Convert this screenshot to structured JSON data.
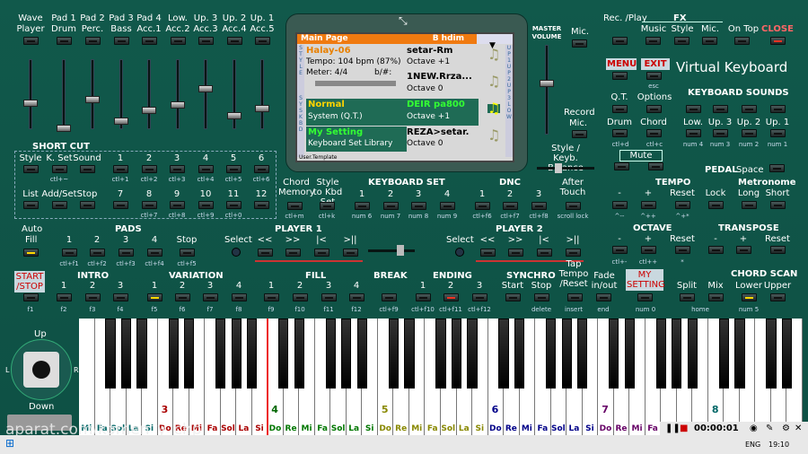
{
  "top_labels": [
    [
      "Wave",
      "Player"
    ],
    [
      "Pad 1",
      "Drum"
    ],
    [
      "Pad 2",
      "Perc."
    ],
    [
      "Pad 3",
      "Bass"
    ],
    [
      "Pad 4",
      "Acc.1"
    ],
    [
      "Low.",
      "Acc.2"
    ],
    [
      "Up. 3",
      "Acc.3"
    ],
    [
      "Up. 2",
      "Acc.4"
    ],
    [
      "Up. 1",
      "Acc.5"
    ]
  ],
  "shortcut": {
    "title": "SHORT CUT",
    "row1": [
      "Style",
      "K. Set",
      "Sound",
      "1",
      "2",
      "3",
      "4",
      "5",
      "6"
    ],
    "row1_keys": [
      "ctl+~",
      "ctl+1",
      "ctl+2",
      "ctl+3",
      "ctl+4",
      "ctl+5",
      "ctl+6"
    ],
    "row2": [
      "List",
      "Add/Set",
      "Stop",
      "7",
      "8",
      "9",
      "10",
      "11",
      "12"
    ],
    "row2_keys": [
      "ctl+7",
      "ctl+8",
      "ctl+9",
      "ctl+0"
    ]
  },
  "screen": {
    "tab": "Main Page",
    "key": "B hdim",
    "style_name": "Halay-06",
    "tempo": "Tempo: 104 bpm (87%)",
    "meter": "Meter: 4/4",
    "bpm": "b/#:",
    "sound1": "setar-Rm",
    "sound1_oct": "Octave +1",
    "sound2": "1NEW.Rrza...",
    "sound2_oct": "Octave 0",
    "sys_name": "Normal",
    "sys_sub": "System (Q.T.)",
    "sound3": "DEIR pa800",
    "sound3_oct": "Octave +1",
    "kbd_name": "My Setting",
    "kbd_sub": "Keyboard Set Library",
    "sound4": "REZA>setar.",
    "sound4_oct": "Octave 0",
    "footer": "User.Template",
    "side_left": "STYLE",
    "side_left2": "SYSKBD",
    "side_right": "UP1UP2UP3LOW"
  },
  "master": {
    "title": "MASTER VOLUME",
    "mic": "Mic.",
    "record": "Record",
    "record_mic": "Mic.",
    "balance": "Style / Keyb. Balance"
  },
  "right": {
    "rec_play": "Rec. /Play",
    "fx": "FX",
    "music": "Music",
    "style": "Style",
    "mic": "Mic.",
    "on_top": "On Top",
    "close": "CLOSE",
    "menu": "MENU",
    "exit": "EXIT",
    "esc": "esc",
    "title": "Virtual Keyboard",
    "qt": "Q.T.",
    "options": "Options",
    "drum": "Drum",
    "chord": "Chord",
    "ctld": "ctl+d",
    "ctlc": "ctl+c",
    "mute": "Mute",
    "kbd_sounds": "KEYBOARD SOUNDS",
    "ks": [
      "Low.",
      "Up. 3",
      "Up. 2",
      "Up. 1"
    ],
    "ks_keys": [
      "num 4",
      "num 3",
      "num 2",
      "num 1"
    ],
    "pedal": "PEDAL",
    "space": "Space",
    "tempo": "TEMPO",
    "metronome": "Metronome",
    "tempo_btns": [
      "-",
      "+",
      "Reset",
      "Lock",
      "Long",
      "Short"
    ],
    "tempo_keys": [
      "^--",
      "^++",
      "^+*"
    ],
    "octave": "OCTAVE",
    "transpose": "TRANSPOSE",
    "oct_btns": [
      "-",
      "+",
      "Reset",
      "-",
      "+",
      "Reset"
    ],
    "oct_keys": [
      "ctl+-",
      "ctl++",
      "*"
    ],
    "chord_scan": "CHORD SCAN",
    "cs": [
      "Split",
      "Mix",
      "Lower",
      "Upper"
    ],
    "cs_keys": [
      "home",
      "num 5"
    ],
    "my_setting": "MY SETTING",
    "my_key": "num 0"
  },
  "mid": {
    "chord_memory": "Chord Memory",
    "style_kbd": "Style to Kbd Set",
    "ctlm": "ctl+m",
    "ctlk": "ctl+k",
    "kbd_set": "KEYBOARD SET",
    "ks_nums": [
      "1",
      "2",
      "3",
      "4"
    ],
    "ks_keys": [
      "num 6",
      "num 7",
      "num 8",
      "num 9"
    ],
    "dnc": "DNC",
    "dnc_nums": [
      "1",
      "2",
      "3"
    ],
    "dnc_keys": [
      "ctl+f6",
      "ctl+f7",
      "ctl+f8"
    ],
    "after_touch": "After Touch",
    "scroll": "scroll lock"
  },
  "pads": {
    "auto": "Auto",
    "fill": "Fill",
    "title": "PADS",
    "nums": [
      "1",
      "2",
      "3",
      "4",
      "Stop"
    ],
    "keys": [
      "ctl+f1",
      "ctl+f2",
      "ctl+f3",
      "ctl+f4",
      "ctl+f5"
    ]
  },
  "player1": {
    "title": "PLAYER 1",
    "select": "Select",
    "ctrls": [
      "<<",
      ">>",
      "|<",
      ">||"
    ]
  },
  "player2": {
    "title": "PLAYER 2",
    "select": "Select",
    "ctrls": [
      "<<",
      ">>",
      "|<",
      ">||"
    ]
  },
  "bottom": {
    "start": "START /STOP",
    "intro": "INTRO",
    "variation": "VARIATION",
    "fill": "FILL",
    "break": "BREAK",
    "ending": "ENDING",
    "synchro": "SYNCHRO",
    "start2": "Start",
    "stop2": "Stop",
    "tap": "Tap Tempo /Reset",
    "fade": "Fade in/out",
    "fkeys": [
      "f1",
      "f2",
      "f3",
      "f4",
      "f5",
      "f6",
      "f7",
      "f8",
      "f9",
      "f10",
      "f11",
      "f12",
      "ctl+f9",
      "ctl+f10",
      "ctl+f11",
      "ctl+f12",
      "delete",
      "insert",
      "end"
    ]
  },
  "joystick": {
    "up": "Up",
    "down": "Down",
    "left": "L",
    "right": "R"
  },
  "notes": [
    "Mi",
    "Fa",
    "Sol",
    "La",
    "Si",
    "Do",
    "Re",
    "Mi",
    "Fa",
    "Sol",
    "La",
    "Si",
    "Do",
    "Re",
    "Mi",
    "Fa",
    "Sol",
    "La",
    "Si",
    "Do",
    "Re",
    "Mi",
    "Fa",
    "Sol",
    "La",
    "Si",
    "Do",
    "Re",
    "Mi",
    "Fa",
    "Sol",
    "La",
    "Si",
    "Do",
    "Re",
    "Mi",
    "Fa",
    "Sol",
    "La",
    "Si",
    "Do",
    "Re",
    "Mi",
    "Fa",
    "Sol",
    "La"
  ],
  "octaves": [
    "3",
    "4",
    "5",
    "6",
    "7",
    "8"
  ],
  "watermark": "aparat.com/komen_y_chp",
  "video_time": "00:00:01",
  "taskbar": {
    "lang": "ENG",
    "time": "19:10"
  }
}
